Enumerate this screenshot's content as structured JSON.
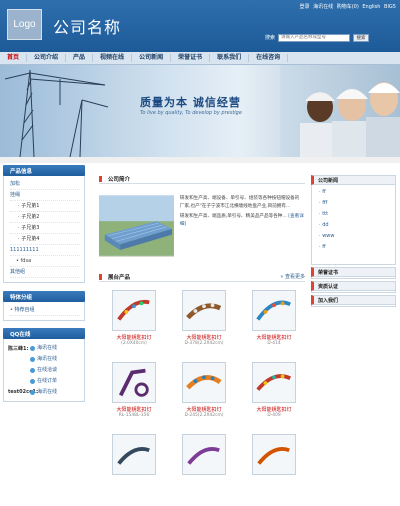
{
  "header": {
    "logo_text": "Logo",
    "company_name": "公司名称",
    "top_links": [
      "登录",
      "海讯在线",
      "购物车(0)",
      "English",
      "BIG5"
    ],
    "search_label": "搜索",
    "search_placeholder": "请输入产品名称或型号",
    "search_button": "搜索"
  },
  "nav": [
    "首页",
    "公司介绍",
    "产品",
    "视频在线",
    "公司新闻",
    "荣誉证书",
    "联系我们",
    "在线咨询"
  ],
  "banner": {
    "title": "质量为本   诚信经营",
    "subtitle": "To live by quality, To develop by prestige"
  },
  "left": {
    "category_title": "产品信息",
    "categories": [
      {
        "label": "加松",
        "level": 0
      },
      {
        "label": "挂绳",
        "level": 0
      },
      {
        "label": "子兄弟1",
        "level": 1
      },
      {
        "label": "子兄弟2",
        "level": 1
      },
      {
        "label": "子兄弟3",
        "level": 1
      },
      {
        "label": "子兄弟4",
        "level": 1
      },
      {
        "label": "111111111",
        "level": 0
      },
      {
        "label": "fdsa",
        "level": 2
      },
      {
        "label": "其他组",
        "level": 0
      }
    ],
    "feature_title": "特体分组",
    "feature_items": [
      "特荐自组"
    ],
    "qq_title": "QQ在线",
    "qq": [
      {
        "name": "陈三峰1:",
        "links": [
          "海讯在线",
          "海讯在线",
          "在线洽谈",
          "在线订单"
        ]
      },
      {
        "name": "test02ce1:",
        "links": [
          "海讯在线"
        ]
      }
    ]
  },
  "center": {
    "intro_title": "公司简介",
    "intro_text": "研发和生产高、端设备、单引号、组装等各种按钮帽设备的厂家,也产\"在子宁波市江北横塘线地盘产业,目前拥有...",
    "intro_text2": "研发和生产高、端品质,单引号、精美品产品等各种...",
    "intro_more": "[查看详细]",
    "products_title": "展台产品",
    "products_more": "查看更多",
    "products": [
      {
        "name": "大阳能钥匙扣灯",
        "code": "(2.0X40cm)"
      },
      {
        "name": "大阳能钥匙扣灯",
        "code": "D-378(2.2X42cm)"
      },
      {
        "name": "大阳能钥匙扣灯",
        "code": "D-414"
      },
      {
        "name": "大阳能钥匙扣灯",
        "code": "RL-1548L-156"
      },
      {
        "name": "大阳能钥匙扣灯",
        "code": "D-245(2.2X42cm)"
      },
      {
        "name": "大阳能钥匙扣灯",
        "code": "D-409"
      },
      {
        "name": "",
        "code": ""
      },
      {
        "name": "",
        "code": ""
      },
      {
        "name": "",
        "code": ""
      }
    ]
  },
  "right": {
    "news_title": "公司新闻",
    "news": [
      "ff",
      "fff",
      "ttt",
      "dd",
      "www",
      "ff"
    ],
    "boxes": [
      "荣誉证书",
      "资质认证",
      "加入我们"
    ]
  },
  "colors": {
    "header_blue": "#1d5a98",
    "nav_bg": "#d8e4ef",
    "accent_red": "#dd4433",
    "link_blue": "#2b5d91"
  }
}
